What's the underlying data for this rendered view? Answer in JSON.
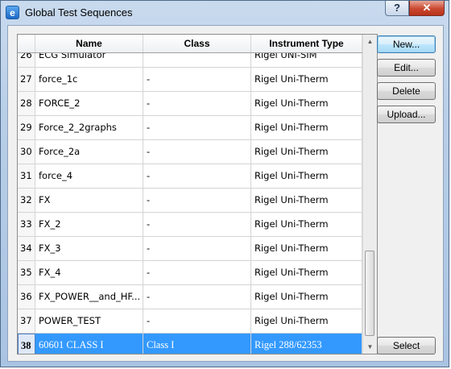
{
  "window": {
    "title": "Global Test Sequences",
    "help_label": "?",
    "close_label": "✕",
    "app_icon_glyph": "e"
  },
  "table": {
    "columns": [
      "Name",
      "Class",
      "Instrument Type"
    ],
    "partial_row": {
      "num": "26",
      "name": "ECG Simulator",
      "class": "",
      "instrument": "Rigel UNI-SIM"
    },
    "rows": [
      {
        "num": "27",
        "name": "force_1c",
        "class": "-",
        "instrument": "Rigel Uni-Therm"
      },
      {
        "num": "28",
        "name": "FORCE_2",
        "class": "-",
        "instrument": "Rigel Uni-Therm"
      },
      {
        "num": "29",
        "name": "Force_2_2graphs",
        "class": "-",
        "instrument": "Rigel Uni-Therm"
      },
      {
        "num": "30",
        "name": "Force_2a",
        "class": "-",
        "instrument": "Rigel Uni-Therm"
      },
      {
        "num": "31",
        "name": "force_4",
        "class": "-",
        "instrument": "Rigel Uni-Therm"
      },
      {
        "num": "32",
        "name": "FX",
        "class": "-",
        "instrument": "Rigel Uni-Therm"
      },
      {
        "num": "33",
        "name": "FX_2",
        "class": "-",
        "instrument": "Rigel Uni-Therm"
      },
      {
        "num": "34",
        "name": "FX_3",
        "class": "-",
        "instrument": "Rigel Uni-Therm"
      },
      {
        "num": "35",
        "name": "FX_4",
        "class": "-",
        "instrument": "Rigel Uni-Therm"
      },
      {
        "num": "36",
        "name": "FX_POWER__and_HF...",
        "class": "-",
        "instrument": "Rigel Uni-Therm"
      },
      {
        "num": "37",
        "name": "POWER_TEST",
        "class": "-",
        "instrument": "Rigel Uni-Therm"
      },
      {
        "num": "38",
        "name": "60601 CLASS I",
        "class": "Class I",
        "instrument": "Rigel 288/62353",
        "selected": true
      }
    ]
  },
  "buttons": {
    "new": "New...",
    "edit": "Edit...",
    "delete": "Delete",
    "upload": "Upload...",
    "select": "Select"
  },
  "scrollbar": {
    "up_icon": "scroll-up-arrow",
    "down_icon": "scroll-down-arrow",
    "position": 0.9
  },
  "colors": {
    "selection": "#3399ff",
    "close_button": "#c9472f"
  }
}
